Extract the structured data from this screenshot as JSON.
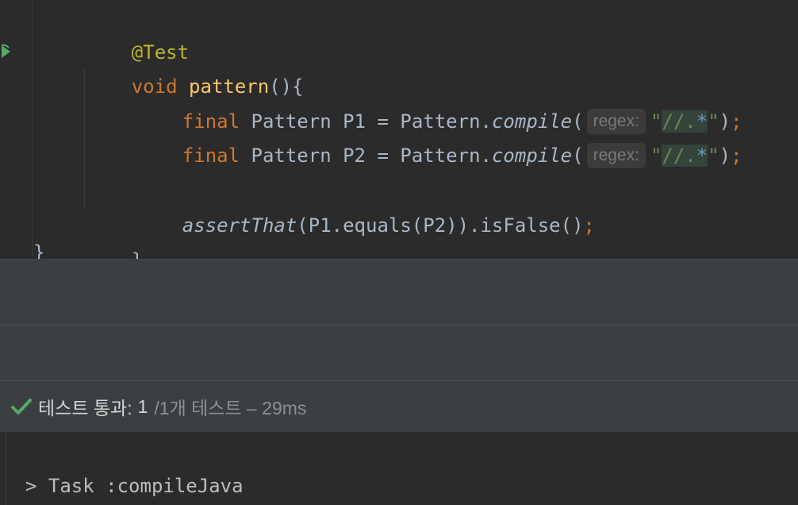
{
  "editor": {
    "line1": {
      "annotation": "@Test"
    },
    "line2": {
      "keyword": "void",
      "method": "pattern",
      "rest": "(){"
    },
    "line3": {
      "kw": "final",
      "type": "Pattern",
      "var": "P1",
      "eq": "=",
      "cls": "Pattern.",
      "call": "compile",
      "open": "(",
      "hint": "regex:",
      "q1": "\"",
      "frag": "//.",
      "star": "*",
      "q2": "\"",
      "close": ")",
      "semi": ";"
    },
    "line4": {
      "kw": "final",
      "type": "Pattern",
      "var": "P2",
      "eq": "=",
      "cls": "Pattern.",
      "call": "compile",
      "open": "(",
      "hint": "regex:",
      "q1": "\"",
      "frag": "//.",
      "star": "*",
      "q2": "\"",
      "close": ")",
      "semi": ";"
    },
    "line6": {
      "call": "assertThat",
      "args": "(P1.equals(P2)).isFalse()",
      "semi": ";"
    },
    "line7": {
      "brace": "}"
    },
    "line8": {
      "brace": "}"
    }
  },
  "status": {
    "passed_label": "테스트 통과:",
    "count": "1",
    "detail": "/1개 테스트 – 29ms",
    "check_color": "#59a869"
  },
  "console": {
    "line": "> Task :compileJava"
  }
}
